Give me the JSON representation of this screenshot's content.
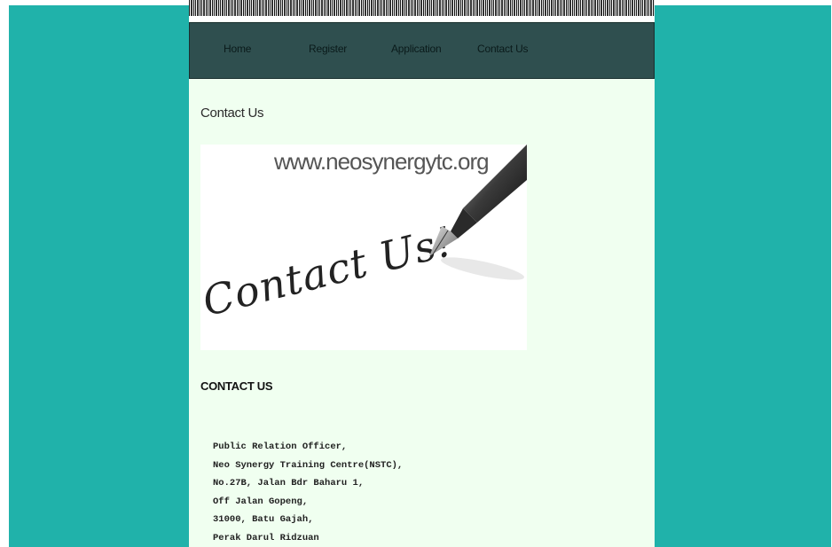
{
  "nav": {
    "items": [
      {
        "label": "Home"
      },
      {
        "label": "Register"
      },
      {
        "label": "Application"
      },
      {
        "label": "Contact Us"
      }
    ]
  },
  "main": {
    "page_title": "Contact Us",
    "image": {
      "url_text": "www.neosynergytc.org",
      "script_text": "Contact Us!"
    },
    "section_heading": "CONTACT US",
    "address_lines": [
      "Public Relation Officer,",
      "Neo Synergy Training Centre(NSTC),",
      "No.27B, Jalan Bdr Baharu 1,",
      "Off Jalan Gopeng,",
      "31000, Batu Gajah,",
      "Perak Darul Ridzuan"
    ]
  },
  "colors": {
    "background": "#20b2aa",
    "page": "#f0fff0",
    "nav": "#2f4f4f"
  },
  "icons": {
    "pen": "fountain-pen-icon"
  }
}
